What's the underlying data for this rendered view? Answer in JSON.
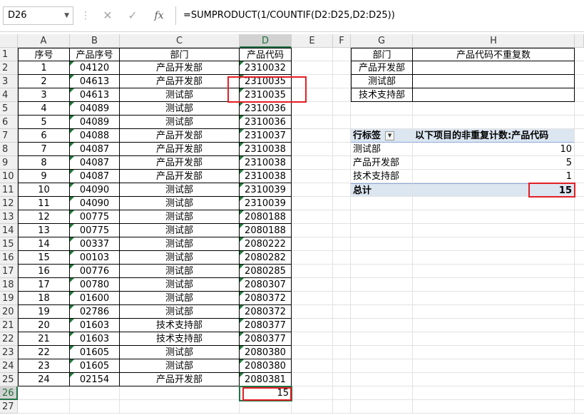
{
  "formula_bar": {
    "name_box": "D26",
    "formula": "=SUMPRODUCT(1/COUNTIF(D2:D25,D2:D25))",
    "cancel_icon": "close-icon",
    "enter_icon": "check-icon",
    "fx_label": "fx"
  },
  "columns": [
    "A",
    "B",
    "C",
    "D",
    "E",
    "F",
    "G",
    "H"
  ],
  "rows": [
    "1",
    "2",
    "3",
    "4",
    "5",
    "6",
    "7",
    "8",
    "9",
    "10",
    "11",
    "12",
    "13",
    "14",
    "15",
    "16",
    "17",
    "18",
    "19",
    "20",
    "21",
    "22",
    "23",
    "24",
    "25",
    "26",
    "27"
  ],
  "table": {
    "headers": [
      "序号",
      "产品序号",
      "部门",
      "产品代码"
    ],
    "rows": [
      [
        "1",
        "04120",
        "产品开发部",
        "2310032"
      ],
      [
        "2",
        "04613",
        "产品开发部",
        "2310035"
      ],
      [
        "3",
        "04613",
        "测试部",
        "2310035"
      ],
      [
        "4",
        "04089",
        "测试部",
        "2310036"
      ],
      [
        "5",
        "04089",
        "测试部",
        "2310036"
      ],
      [
        "6",
        "04088",
        "产品开发部",
        "2310037"
      ],
      [
        "7",
        "04087",
        "产品开发部",
        "2310038"
      ],
      [
        "8",
        "04087",
        "产品开发部",
        "2310038"
      ],
      [
        "9",
        "04087",
        "产品开发部",
        "2310038"
      ],
      [
        "10",
        "04090",
        "测试部",
        "2310039"
      ],
      [
        "11",
        "04090",
        "测试部",
        "2310039"
      ],
      [
        "12",
        "00775",
        "测试部",
        "2080188"
      ],
      [
        "13",
        "00775",
        "测试部",
        "2080188"
      ],
      [
        "14",
        "00337",
        "测试部",
        "2080222"
      ],
      [
        "15",
        "00103",
        "测试部",
        "2080282"
      ],
      [
        "16",
        "00776",
        "测试部",
        "2080285"
      ],
      [
        "17",
        "00780",
        "测试部",
        "2080307"
      ],
      [
        "18",
        "01600",
        "测试部",
        "2080372"
      ],
      [
        "19",
        "02786",
        "测试部",
        "2080372"
      ],
      [
        "20",
        "01603",
        "技术支持部",
        "2080377"
      ],
      [
        "21",
        "01603",
        "技术支持部",
        "2080377"
      ],
      [
        "22",
        "01605",
        "测试部",
        "2080380"
      ],
      [
        "23",
        "01605",
        "测试部",
        "2080380"
      ],
      [
        "24",
        "02154",
        "产品开发部",
        "2080381"
      ]
    ],
    "result_value": "15"
  },
  "summary": {
    "headers": [
      "部门",
      "产品代码不重复数"
    ],
    "rows": [
      "产品开发部",
      "测试部",
      "技术支持部"
    ]
  },
  "pivot": {
    "row_label": "行标签",
    "value_label": "以下项目的非重复计数:产品代码",
    "rows": [
      {
        "label": "测试部",
        "value": "10"
      },
      {
        "label": "产品开发部",
        "value": "5"
      },
      {
        "label": "技术支持部",
        "value": "1"
      }
    ],
    "total_label": "总计",
    "total_value": "15"
  },
  "colors": {
    "selection": "#217346",
    "highlight": "#e31e24",
    "pivot_fill": "#dce6f1"
  }
}
